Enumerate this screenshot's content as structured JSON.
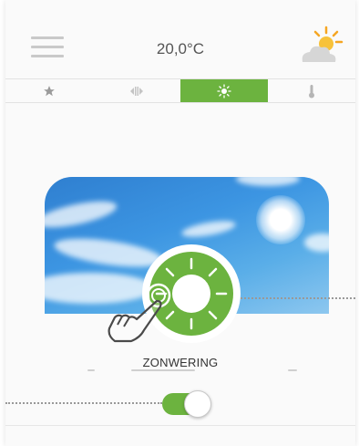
{
  "header": {
    "menu_icon": "hamburger-menu-icon",
    "temperature": "20,0°C",
    "weather_icon": "partly-sunny-icon"
  },
  "tabs": [
    {
      "icon": "star-icon",
      "active": false
    },
    {
      "icon": "blinds-icon",
      "active": false
    },
    {
      "icon": "sun-icon",
      "active": true
    },
    {
      "icon": "thermometer-icon",
      "active": false
    }
  ],
  "main": {
    "control_label": "ZONWERING",
    "toggle_on": true,
    "dial_icon": "sun-dial-icon",
    "gesture_icon": "tap-hand-icon"
  },
  "colors": {
    "accent": "#6cb33f",
    "sky": "#3c95e2",
    "text": "#333333"
  }
}
